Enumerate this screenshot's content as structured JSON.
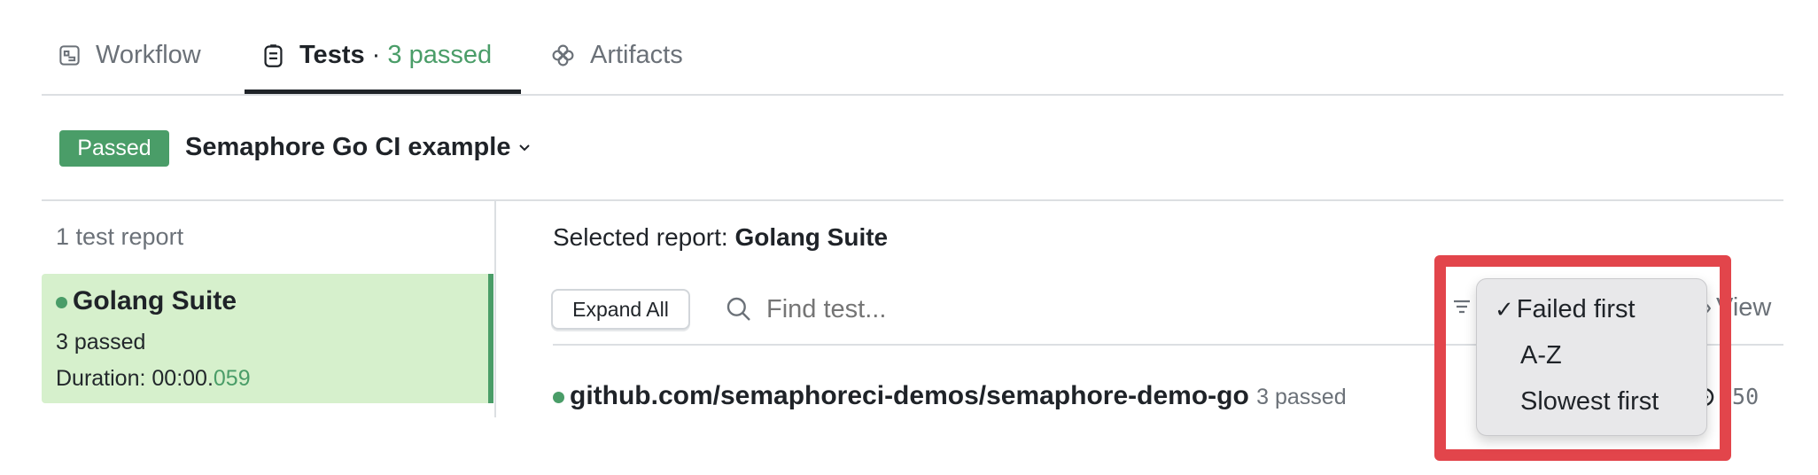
{
  "tabs": [
    {
      "label": "Workflow",
      "icon": "workflow-icon"
    },
    {
      "label": "Tests",
      "separator": " · ",
      "count_label": "3 passed",
      "icon": "clipboard-icon",
      "active": true
    },
    {
      "label": "Artifacts",
      "icon": "artifacts-icon"
    }
  ],
  "pipeline": {
    "status": "Passed",
    "name": "Semaphore Go CI example"
  },
  "sidebar": {
    "heading": "1 test report",
    "reports": [
      {
        "name": "Golang Suite",
        "summary": "3 passed",
        "duration_label": "Duration: 00:00.",
        "duration_ms": "059"
      }
    ]
  },
  "main": {
    "selected_prefix": "Selected report: ",
    "selected_name": "Golang Suite",
    "expand_all": "Expand All",
    "search_placeholder": "Find test...",
    "view_label": "View",
    "suites": [
      {
        "name": "github.com/semaphoreci-demos/semaphore-demo-go",
        "summary": "3 passed",
        "duration": "050"
      }
    ]
  },
  "sort_menu": {
    "items": [
      {
        "label": "Failed first",
        "checked": true
      },
      {
        "label": "A-Z"
      },
      {
        "label": "Slowest first"
      }
    ]
  },
  "colors": {
    "accent_green": "#4a9d68",
    "card_bg": "#d6f0cc",
    "highlight_red": "#e2454b"
  }
}
